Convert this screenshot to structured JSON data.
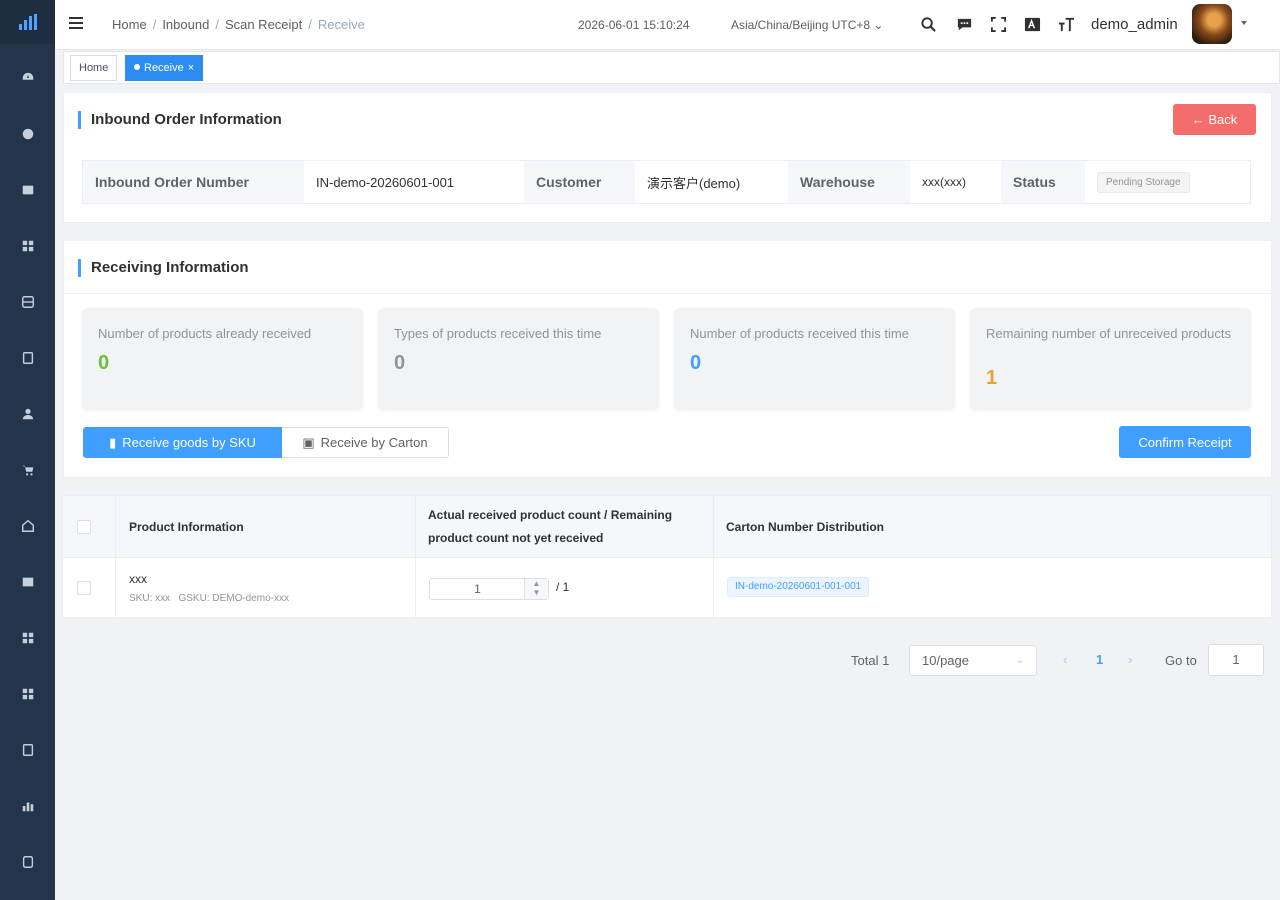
{
  "header": {
    "breadcrumb": [
      "Home",
      "Inbound",
      "Scan Receipt",
      "Receive"
    ],
    "datetime": "2026-06-01 15:10:24",
    "timezone": "Asia/China/Beijing UTC+8",
    "username": "demo_admin"
  },
  "tags": {
    "home": "Home",
    "active": "Receive"
  },
  "order_card": {
    "title": "Inbound Order Information",
    "back_label": "← Back",
    "fields": {
      "number_label": "Inbound Order Number",
      "number_value": "IN-demo-20260601-001",
      "customer_label": "Customer",
      "customer_value": "演示客户(demo)",
      "warehouse_label": "Warehouse",
      "warehouse_value": "xxx(xxx)",
      "status_label": "Status",
      "status_value": "Pending Storage"
    }
  },
  "receiving_card": {
    "title": "Receiving Information",
    "stats": [
      {
        "label": "Number of products already received",
        "value": "0",
        "color": "#67c23a"
      },
      {
        "label": "Types of products received this time",
        "value": "0",
        "color": "#909399"
      },
      {
        "label": "Number of products received this time",
        "value": "0",
        "color": "#409eff"
      },
      {
        "label": "Remaining number of unreceived products",
        "value": "1",
        "color": "#e6a23c"
      }
    ],
    "btn_sku": "Receive goods by SKU",
    "btn_carton": "Receive by Carton",
    "btn_confirm": "Confirm Receipt"
  },
  "table": {
    "columns": {
      "product": "Product Information",
      "count_line1": "Actual received product count / Remaining",
      "count_line2": "product count not yet received",
      "carton": "Carton Number Distribution"
    },
    "rows": [
      {
        "name": "xxx",
        "sku": "SKU: xxx   GSKU: DEMO-demo-xxx",
        "received": "1",
        "remaining": "/ 1",
        "carton": "IN-demo-20260601-001-001"
      }
    ]
  },
  "pagination": {
    "total": "Total 1",
    "page_size": "10/page",
    "current_page": "1",
    "goto_label": "Go to",
    "goto_value": "1"
  },
  "colors": {
    "sidebar": "#24344a",
    "primary": "#409eff",
    "danger": "#f56c6c"
  }
}
